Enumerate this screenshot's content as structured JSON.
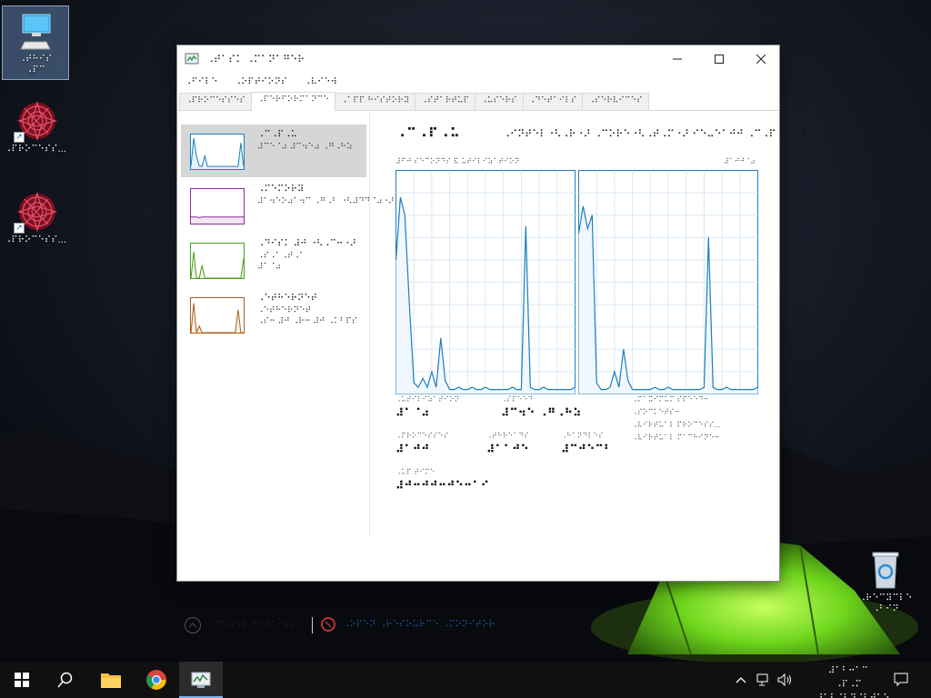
{
  "desktop": {
    "icons": [
      {
        "label": "⠠⠞⠓⠊⠎\n⠠⠏⠉",
        "icon": "this-pc-icon"
      },
      {
        "label": "⠠⠏⠗⠕⠉⠑⠎⠎...",
        "icon": "app-shortcut-icon"
      },
      {
        "label": "⠠⠏⠗⠕⠉⠑⠎⠎...",
        "icon": "app-shortcut-icon"
      },
      {
        "label": "⠠⠗⠑⠉⠽⠉⠇⠑\n⠠⠃⠊⠝",
        "icon": "recycle-bin-icon"
      }
    ]
  },
  "window": {
    "title": "⠠⠞⠁⠎⠅ ⠠⠍⠁⠝⠁⠛⠑⠗",
    "menu": [
      "⠠⠋⠊⠇⠑",
      "⠠⠕⠏⠞⠊⠕⠝⠎",
      "⠠⠧⠊⠑⠺"
    ],
    "tabs": [
      "⠠⠏⠗⠕⠉⠑⠎⠎⠑⠎",
      "⠠⠏⠑⠗⠋⠕⠗⠍⠁⠝⠉⠑",
      "⠠⠁⠏⠏ ⠓⠊⠎⠞⠕⠗⠽",
      "⠠⠎⠞⠁⠗⠞⠥⠏",
      "⠠⠥⠎⠑⠗⠎",
      "⠠⠙⠑⠞⠁⠊⠇⠎",
      "⠠⠎⠑⠗⠧⠊⠉⠑⠎"
    ],
    "active_tab": 1
  },
  "resources": [
    {
      "name": "⠠⠉⠠⠏⠠⠥",
      "sub1": "⠼⠉⠑⠈⠴ ⠼⠉⠲⠑⠴ ⠠⠛⠠⠓⠵",
      "sub2": "",
      "sub3": "",
      "color": "#1a7fc1",
      "fill": "#e8f2fa"
    },
    {
      "name": "⠠⠍⠑⠍⠕⠗⠽",
      "sub1": "⠼⠁⠲⠑⠕⠴⠁⠲⠉ ⠠⠛⠠⠃ ⠐⠣⠼⠙⠙⠈⠴⠐⠜",
      "sub2": "",
      "sub3": "",
      "color": "#8b2a9b",
      "fill": "#f4e6f6"
    },
    {
      "name": "⠠⠙⠊⠎⠅ ⠼⠚ ⠐⠣⠠⠉⠒⠐⠜",
      "sub1": "⠠⠎⠠⠁⠠⠞⠠⠁",
      "sub2": "⠼⠁⠈⠴",
      "sub3": "",
      "color": "#4c9e1f",
      "fill": "#eef6e8"
    },
    {
      "name": "⠠⠑⠞⠓⠑⠗⠝⠑⠞",
      "sub1": "⠠⠑⠞⠓⠑⠗⠝⠑⠞",
      "sub2": "⠠⠎⠒ ⠼⠚ ⠠⠗⠒ ⠼⠚ ⠠⠅⠃⠏⠎",
      "sub3": "",
      "color": "#a8611c",
      "fill": "#f8efe4"
    }
  ],
  "detail": {
    "title": "⠠⠉⠠⠏⠠⠥",
    "model": "⠠⠊⠝⠞⠑⠇⠐⠣⠠⠗⠐⠜ ⠠⠉⠕⠗⠑⠐⠣⠠⠞⠠⠍⠐⠜ ⠊⠑⠤⠑⠁⠚⠚ ⠠⠉⠠⠏⠠⠥ ⠐⠷ ...",
    "graph_caption": "⠼⠋⠚ ⠎⠑⠉⠕⠝⠙⠎ ⠯ ⠥⠞⠊⠇⠊⠵⠁⠞⠊⠕⠝",
    "graph_max": "⠼⠁⠚⠚⠈⠴",
    "stats": [
      {
        "label": "⠠⠥⠞⠊⠇⠊⠵⠁⠞⠊⠕⠝",
        "value": "⠼⠁⠈⠴"
      },
      {
        "label": "⠠⠎⠏⠑⠑⠙",
        "value": "⠼⠉⠲⠑ ⠠⠛⠠⠓⠵"
      },
      {
        "label": "⠠⠏⠗⠕⠉⠑⠎⠎⠑⠎",
        "value": "⠼⠁⠚⠚"
      },
      {
        "label": "⠠⠞⠓⠗⠑⠁⠙⠎",
        "value": "⠼⠁⠁⠚⠑"
      },
      {
        "label": "⠠⠓⠁⠝⠙⠇⠑⠎",
        "value": "⠼⠉⠚⠑⠉⠃"
      },
      {
        "label": "⠠⠥⠏ ⠞⠊⠍⠑",
        "value": "⠼⠚⠒⠚⠚⠒⠚⠑⠒⠁⠊"
      }
    ],
    "specs": [
      "⠠⠍⠁⠭⠊⠍⠥⠍ ⠎⠏⠑⠑⠙⠒",
      "⠠⠎⠕⠉⠅⠑⠞⠎⠒",
      "⠠⠧⠊⠗⠞⠥⠁⠇ ⠏⠗⠕⠉⠑⠎⠎...",
      "⠠⠧⠊⠗⠞⠥⠁⠇ ⠍⠁⠉⠓⠊⠝⠑⠒"
    ]
  },
  "footer": {
    "fewer_details": "⠠⠋⠑⠺⠑⠗ ⠙⠑⠞⠁⠊⠇⠎",
    "open_monitor": "⠠⠕⠏⠑⠝ ⠠⠗⠑⠎⠕⠥⠗⠉⠑ ⠠⠍⠕⠝⠊⠞⠕⠗"
  },
  "taskbar": {
    "clock_time": "⠼⠁⠃⠒⠁⠉ ⠠⠏⠠⠍",
    "clock_date": "⠼⠁⠃⠌⠃⠙⠌⠃⠚⠁⠑"
  },
  "colors": {
    "cpu_line": "#1a7fc1",
    "cpu_fill": "#f1f7fc",
    "grid": "#d9e8f4",
    "accent": "#7fb2e6"
  },
  "chart_data": {
    "type": "line",
    "series": [
      {
        "values": [
          60,
          88,
          80,
          40,
          5,
          3,
          7,
          3,
          10,
          3,
          25,
          6,
          2,
          2,
          3,
          2,
          2,
          3,
          2,
          2,
          3,
          2,
          2,
          2,
          2,
          2,
          3,
          2,
          2,
          75,
          3,
          2,
          2,
          3,
          2,
          2,
          2,
          2,
          2,
          2,
          3
        ]
      },
      {
        "values": [
          72,
          84,
          74,
          80,
          5,
          2,
          2,
          3,
          10,
          3,
          20,
          6,
          2,
          2,
          2,
          2,
          2,
          3,
          2,
          2,
          3,
          2,
          2,
          2,
          2,
          2,
          2,
          2,
          3,
          70,
          3,
          2,
          2,
          3,
          2,
          2,
          2,
          2,
          2,
          2,
          3
        ]
      }
    ],
    "ylim": [
      0,
      100
    ]
  }
}
